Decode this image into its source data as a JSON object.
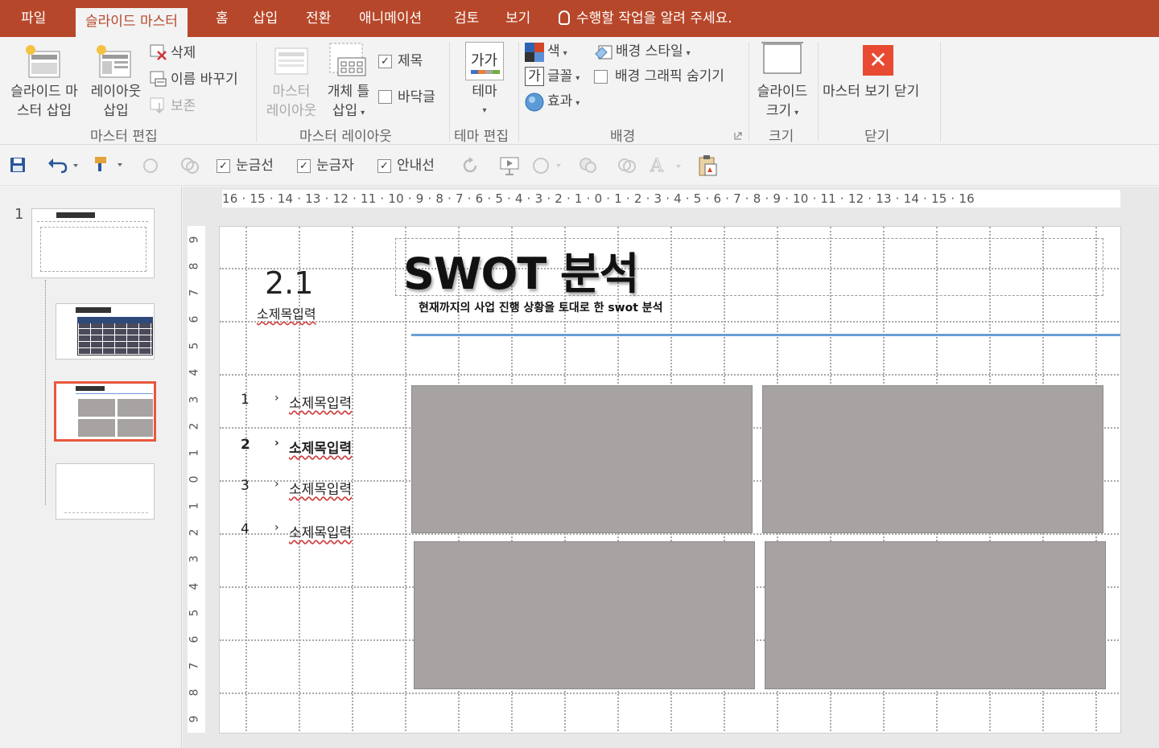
{
  "tabs": [
    {
      "label": "파일",
      "active": false
    },
    {
      "label": "슬라이드 마스터",
      "active": true
    },
    {
      "label": "홈",
      "active": false
    },
    {
      "label": "삽입",
      "active": false
    },
    {
      "label": "전환",
      "active": false
    },
    {
      "label": "애니메이션",
      "active": false
    },
    {
      "label": "검토",
      "active": false
    },
    {
      "label": "보기",
      "active": false
    }
  ],
  "tell_me": "수행할 작업을 알려 주세요.",
  "ribbon": {
    "master_edit": {
      "insert_master_l1": "슬라이드 마",
      "insert_master_l2": "스터 삽입",
      "insert_layout_l1": "레이아웃",
      "insert_layout_l2": "삽입",
      "delete": "삭제",
      "rename": "이름 바꾸기",
      "preserve": "보존",
      "group": "마스터 편집"
    },
    "master_layout": {
      "master_layout_l1": "마스터",
      "master_layout_l2": "레이아웃",
      "placeholder_l1": "개체 틀",
      "placeholder_l2": "삽입",
      "title_cb": "제목",
      "footer_cb": "바닥글",
      "group": "마스터 레이아웃"
    },
    "theme_edit": {
      "theme_glyph": "가가",
      "theme": "테마",
      "group": "테마 편집"
    },
    "background": {
      "colors": "색",
      "fonts_glyph": "가",
      "fonts": "글꼴",
      "effects": "효과",
      "bg_styles": "배경 스타일",
      "hide_bg": "배경 그래픽 숨기기",
      "group": "배경"
    },
    "size": {
      "slide_size_l1": "슬라이드",
      "slide_size_l2": "크기",
      "group": "크기"
    },
    "close": {
      "close_master": "마스터 보기 닫기",
      "group": "닫기"
    }
  },
  "quick": {
    "gridlines": "눈금선",
    "ruler": "눈금자",
    "guides": "안내선"
  },
  "thumbs": {
    "slide_number": "1"
  },
  "hruler": "16 · 15 · 14 · 13 · 12 · 11 · 10 · 9 · 8 · 7 · 6 · 5 · 4 · 3 · 2 · 1 · 0 · 1 · 2 · 3 · 4 · 5 · 6 · 7 · 8 · 9 · 10 · 11 · 12 · 13 · 14 · 15 · 16",
  "vruler": [
    "9",
    "8",
    "7",
    "6",
    "5",
    "4",
    "3",
    "2",
    "1",
    "0",
    "1",
    "2",
    "3",
    "4",
    "5",
    "6",
    "7",
    "8",
    "9"
  ],
  "slide": {
    "section_number": "2.1",
    "section_sub": "소제목입력",
    "title": "SWOT 분석",
    "description": "현재까지의 사업 진행 상황을 토대로 한 swot 분석",
    "list": [
      {
        "n": "1",
        "label": "소제목입력",
        "bold": false
      },
      {
        "n": "2",
        "label": "소제목입력",
        "bold": true
      },
      {
        "n": "3",
        "label": "소제목입력",
        "bold": false
      },
      {
        "n": "4",
        "label": "소제목입력",
        "bold": false
      }
    ],
    "chevron": "›"
  },
  "colors": {
    "accent": "#b7472a",
    "selection": "#e8573e",
    "box": "#a6a3a2",
    "rule": "#6a9ed6"
  }
}
